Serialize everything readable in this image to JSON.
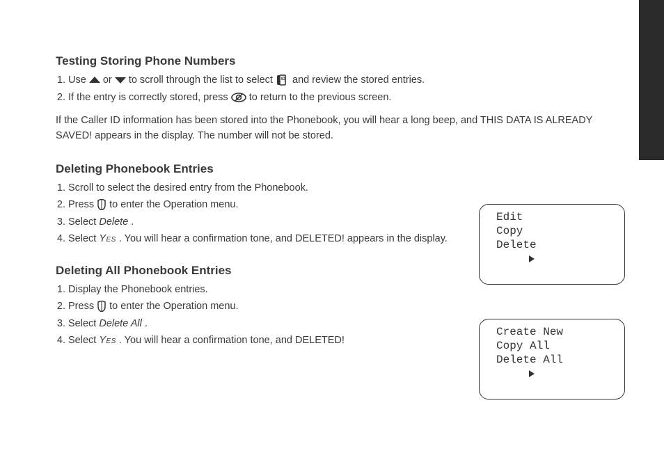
{
  "section1": {
    "heading": "Testing Storing Phone Numbers",
    "ol1a": "Use ",
    "ol1b": " or ",
    "ol1c": " to scroll through the list to select ",
    "ol1d": " and review the stored entries.",
    "ol2a": "If the entry is correctly stored, press ",
    "ol2b": " to return to the previous screen.",
    "trailer": "If the Caller ID information has been stored into the Phonebook, you will hear a long beep, and THIS DATA IS ALREADY SAVED! appears in the display. The number will not be stored."
  },
  "section2": {
    "heading": "Deleting Phonebook Entries",
    "ol1a": "Scroll to select the desired entry from the Phonebook.",
    "ol2a": "Press ",
    "ol2b": " to enter the Operation menu.",
    "ol3a": "Select ",
    "ol3b": "Delete",
    "ol3c": ".",
    "ol4a": "Select ",
    "ol4b": "Yes",
    "ol4c": ". You will hear a confirmation tone, and DELETED! appears in the display."
  },
  "section3": {
    "heading": "Deleting All Phonebook Entries",
    "ol1a": "Display the Phonebook entries.",
    "ol2a": "Press ",
    "ol2b": " to enter the Operation menu.",
    "ol3a": "Select ",
    "ol3b": "Delete All",
    "ol3c": ".",
    "ol4a": "Select ",
    "ol4b": "Yes",
    "ol4c": ". You will hear a confirmation tone, and DELETED!"
  },
  "lcd1": {
    "line1": "Edit",
    "line2": "Copy",
    "line3": "Delete"
  },
  "lcd2": {
    "line1": "Create New",
    "line2": "Copy All",
    "line3": "Delete All"
  },
  "icons": {
    "up": "up-arrow-icon",
    "down": "down-arrow-icon",
    "phonebook": "phonebook-icon",
    "cancel": "cancel-icon",
    "options": "options-icon",
    "cursor": "cursor-right-icon"
  }
}
